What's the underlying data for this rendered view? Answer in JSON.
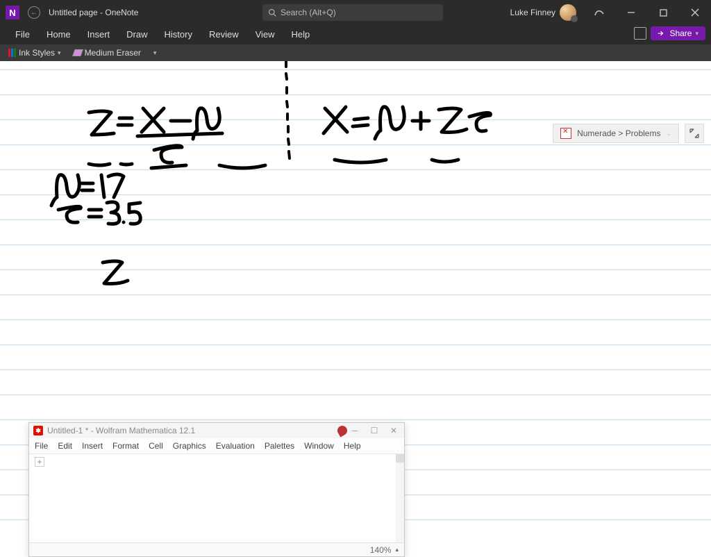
{
  "titlebar": {
    "app_letter": "N",
    "doc_title": "Untitled page  -  OneNote",
    "search_placeholder": "Search (Alt+Q)",
    "username": "Luke Finney"
  },
  "ribbon": {
    "tabs": [
      "File",
      "Home",
      "Insert",
      "Draw",
      "History",
      "Review",
      "View",
      "Help"
    ],
    "share_label": "Share"
  },
  "toolbar": {
    "ink_styles": "Ink Styles",
    "eraser": "Medium Eraser"
  },
  "breadcrumb": {
    "text": "Numerade > Problems"
  },
  "handwriting": {
    "eq1": "Z = (X − μ) / σ",
    "eq2": "X = μ + Z σ",
    "mu": "μ = 17",
    "sigma": "σ = 3.5",
    "loose": "Z"
  },
  "mathematica": {
    "title": "Untitled-1 * - Wolfram Mathematica 12.1",
    "menus": [
      "File",
      "Edit",
      "Insert",
      "Format",
      "Cell",
      "Graphics",
      "Evaluation",
      "Palettes",
      "Window",
      "Help"
    ],
    "zoom": "140%"
  }
}
